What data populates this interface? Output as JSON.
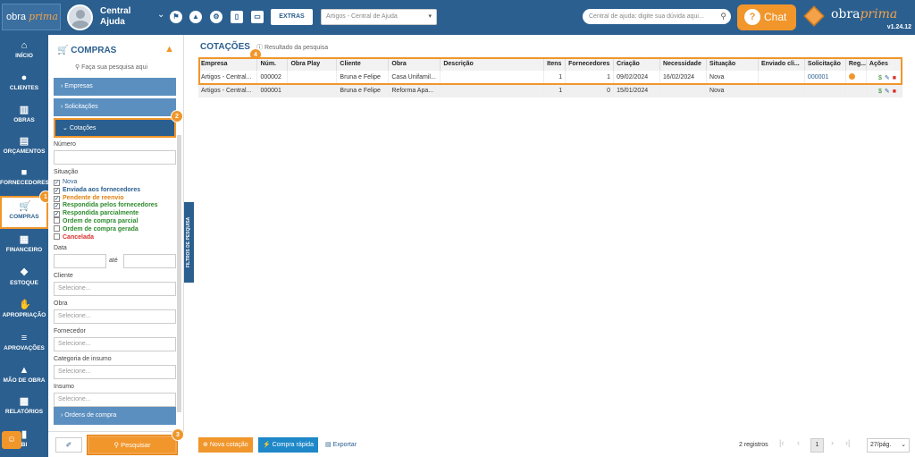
{
  "app": {
    "logo_text": "obra",
    "logo_script": "prima",
    "user_name": "Central Ajuda",
    "extras": "EXTRAS",
    "article_select": "Artigos - Central de Ajuda",
    "help_placeholder": "Central de ajuda: digite sua dúvida aqui...",
    "chat": "Chat",
    "brand_a": "obra",
    "brand_b": "prima",
    "version": "v1.24.12"
  },
  "nav": [
    {
      "label": "INÍCIO",
      "icon": "home-icon"
    },
    {
      "label": "CLIENTES",
      "icon": "user-icon"
    },
    {
      "label": "OBRAS",
      "icon": "building-icon"
    },
    {
      "label": "ORÇAMENTOS",
      "icon": "calculator-icon"
    },
    {
      "label": "FORNECEDORES",
      "icon": "truck-icon"
    },
    {
      "label": "COMPRAS",
      "icon": "cart-icon"
    },
    {
      "label": "FINANCEIRO",
      "icon": "calculator-icon"
    },
    {
      "label": "ESTOQUE",
      "icon": "boxes-icon"
    },
    {
      "label": "APROPRIAÇÃO",
      "icon": "hand-icon"
    },
    {
      "label": "APROVAÇÕES",
      "icon": "check-list-icon"
    },
    {
      "label": "MÃO DE OBRA",
      "icon": "worker-icon"
    },
    {
      "label": "RELATÓRIOS",
      "icon": "report-icon"
    },
    {
      "label": "BI",
      "icon": "chart-icon"
    }
  ],
  "badges": [
    "1",
    "2",
    "3",
    "4"
  ],
  "panel": {
    "title": "COMPRAS",
    "search": "Faça sua pesquisa aqui",
    "acc_empresas": "Empresas",
    "acc_solicitacoes": "Solicitações",
    "acc_cotacoes": "Cotações",
    "acc_ordens": "Ordens de compra",
    "numero": "Número",
    "situacao": "Situação",
    "statuses": [
      {
        "label": "Nova",
        "checked": true,
        "color": "#2b5f8f"
      },
      {
        "label": "Enviada aos fornecedores",
        "checked": true,
        "color": "#2b5f8f"
      },
      {
        "label": "Pendente de reenvio",
        "checked": true,
        "color": "#e08010"
      },
      {
        "label": "Respondida pelos fornecedores",
        "checked": true,
        "color": "#2e8b2e"
      },
      {
        "label": "Respondida parcialmente",
        "checked": true,
        "color": "#2e8b2e"
      },
      {
        "label": "Ordem de compra parcial",
        "checked": false,
        "color": "#2e8b2e"
      },
      {
        "label": "Ordem de compra gerada",
        "checked": false,
        "color": "#2e8b2e"
      },
      {
        "label": "Cancelada",
        "checked": false,
        "color": "#d9302c"
      }
    ],
    "data": "Data",
    "ate": "até",
    "cliente": "Cliente",
    "obra": "Obra",
    "fornecedor": "Fornecedor",
    "categoria": "Categoria de insumo",
    "insumo": "Insumo",
    "selecione": "Selecione...",
    "pesquisar": "Pesquisar",
    "filter_tab": "FILTROS DE PESQUISA"
  },
  "main": {
    "title": "COTAÇÕES",
    "result": "Resultado da pesquisa",
    "columns": [
      "Empresa",
      "Núm.",
      "Obra Play",
      "Cliente",
      "Obra",
      "Descrição",
      "Itens",
      "Fornecedores",
      "Criação",
      "Necessidade",
      "Situação",
      "Enviado cli...",
      "Solicitação",
      "Reg...",
      "Ações"
    ],
    "rows": [
      [
        "Artigos - Central...",
        "000002",
        "",
        "Bruna e Felipe",
        "Casa Unifamil...",
        "",
        "1",
        "1",
        "09/02/2024",
        "16/02/2024",
        "Nova",
        "",
        "000001",
        "",
        ""
      ],
      [
        "Artigos - Central...",
        "000001",
        "",
        "Bruna e Felipe",
        "Reforma Apa...",
        "",
        "1",
        "0",
        "15/01/2024",
        "",
        "Nova",
        "",
        "",
        "",
        ""
      ]
    ],
    "nova_cotacao": "Nova cotação",
    "compra_rapida": "Compra rápida",
    "exportar": "Exportar",
    "registros": "2 registros",
    "page": "1",
    "per_page": "27/pág."
  }
}
